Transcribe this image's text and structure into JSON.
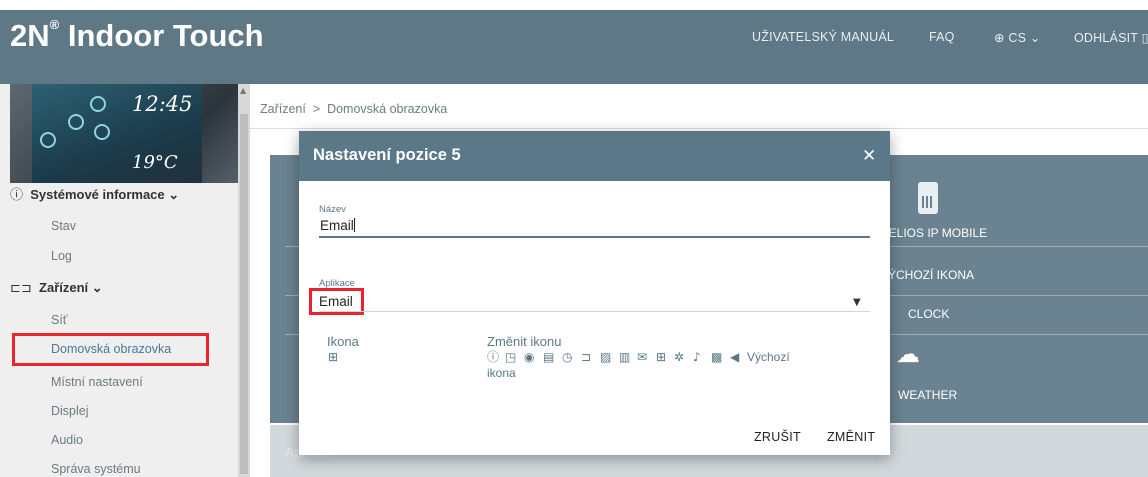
{
  "header": {
    "brand": "2N",
    "brand_reg": "®",
    "brand_rest": " Indoor Touch",
    "nav": {
      "manual": "UŽIVATELSKÝ MANUÁL",
      "faq": "FAQ",
      "lang": "CS",
      "logout": "ODHLÁSIT"
    }
  },
  "device": {
    "time": "12:45",
    "temp": "19°C"
  },
  "sidebar": {
    "sections": [
      {
        "label": "Systémové informace",
        "items": [
          "Stav",
          "Log"
        ]
      },
      {
        "label": "Zařízení",
        "items": [
          "Síť",
          "Domovská obrazovka",
          "Místní nastavení",
          "Displej",
          "Audio",
          "Správa systému"
        ]
      }
    ]
  },
  "breadcrumb": {
    "root": "Zařízení",
    "separator": ">",
    "current": "Domovská obrazovka"
  },
  "background_panel": {
    "items": [
      "HELIOS IP MOBILE",
      "VÝCHOZÍ IKONA",
      "CLOCK",
      "WEATHER"
    ],
    "section": "Aplikace"
  },
  "modal": {
    "title": "Nastavení pozice 5",
    "name_label": "Název",
    "name_value": "Email",
    "app_label": "Aplikace",
    "app_value": "Email",
    "icon_label": "Ikona",
    "change_icon_label": "Změnit ikonu",
    "default_icon_link_1": "Výchozí",
    "default_icon_link_2": "ikona",
    "cancel": "ZRUŠIT",
    "confirm": "ZMĚNIT"
  },
  "colors": {
    "header": "#5e7985",
    "modal_header": "#5b7888",
    "highlight": "#e8242c"
  }
}
